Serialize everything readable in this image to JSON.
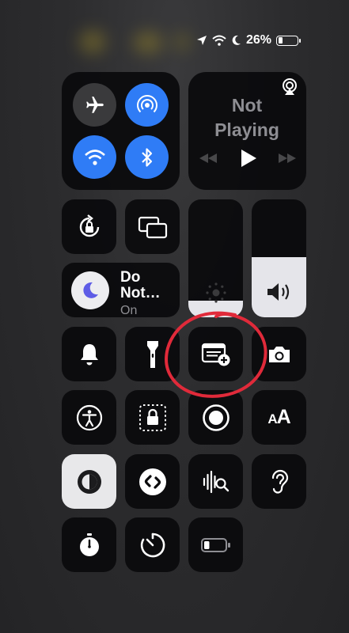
{
  "status_bar": {
    "battery_text": "26%",
    "battery_level": 0.26,
    "icons": [
      "location-arrow-icon",
      "wifi-icon",
      "moon-icon",
      "battery-icon"
    ]
  },
  "connectivity": {
    "airplane": "airplane-icon",
    "airdrop": "airdrop-icon",
    "wifi": "wifi-icon",
    "bluetooth": "bluetooth-icon"
  },
  "now_playing": {
    "title_line1": "Not",
    "title_line2": "Playing"
  },
  "focus": {
    "title_line1": "Do",
    "title_line2": "Not…",
    "status": "On"
  },
  "brightness_level": 0.14,
  "volume_level": 0.51,
  "text_size_label": "AA",
  "colors": {
    "accent_blue": "#2f7cf6",
    "tile_bg": "#0a0a0c",
    "annotation_red": "#e02a3a",
    "focus_purple": "#5e5ce6"
  }
}
